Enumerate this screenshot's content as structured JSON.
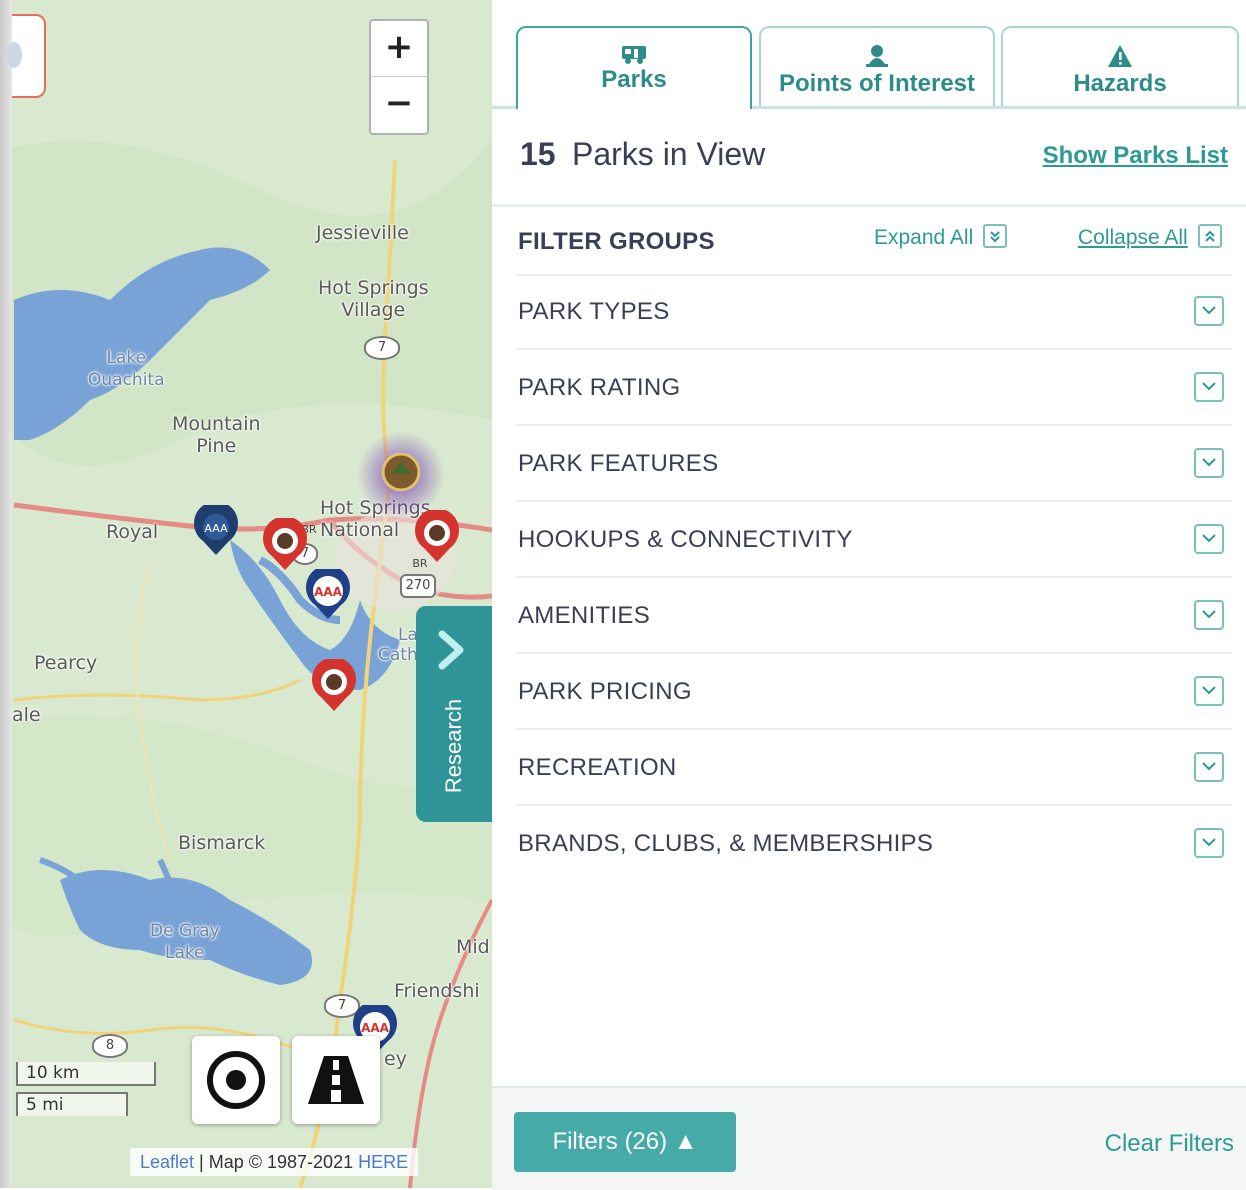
{
  "map": {
    "zoom_in": "+",
    "zoom_out": "−",
    "places": [
      "Jessieville",
      "Hot Springs\nVillage",
      "Lake\nOuachita",
      "Mountain\nPine",
      "Hot Springs\nNational",
      "Royal",
      "Pearcy",
      "ale",
      "Bismarck",
      "De Gray\nLake",
      "Mid",
      "Friendshi",
      "La",
      "Cath",
      "ey"
    ],
    "shields": [
      "7",
      "BR",
      "270",
      "7",
      "BR",
      "7",
      "8"
    ],
    "research_label": "Research",
    "scale_km": "10 km",
    "scale_mi": "5 mi",
    "attribution": {
      "leaflet": "Leaflet",
      "text": " | Map © 1987-2021 ",
      "here": "HERE"
    },
    "locate_icon": "locate-icon",
    "road_icon": "road-icon",
    "colors": {
      "land": "#d9e9cf",
      "water": "#79a3d6",
      "research_tab": "#2f9497",
      "road_major": "#e58b86",
      "road_minor": "#f1d47a"
    }
  },
  "tabs": [
    {
      "label": "Parks",
      "icon": "rv-icon",
      "active": true
    },
    {
      "label": "Points of Interest",
      "icon": "person-pin-icon",
      "active": false
    },
    {
      "label": "Hazards",
      "icon": "warning-icon",
      "active": false
    }
  ],
  "summary": {
    "count": "15",
    "label": "Parks in View",
    "show_list": "Show Parks List"
  },
  "filter_groups": {
    "title": "FILTER GROUPS",
    "expand_all": "Expand All",
    "collapse_all": "Collapse All"
  },
  "filters": [
    "PARK TYPES",
    "PARK RATING",
    "PARK FEATURES",
    "HOOKUPS & CONNECTIVITY",
    "AMENITIES",
    "PARK PRICING",
    "RECREATION",
    "BRANDS, CLUBS, & MEMBERSHIPS"
  ],
  "footer": {
    "filters_button": "Filters (26) ▲",
    "clear": "Clear Filters"
  },
  "colors": {
    "accent": "#2d9a96",
    "button": "#45aaa8",
    "text": "#3a3f55"
  }
}
